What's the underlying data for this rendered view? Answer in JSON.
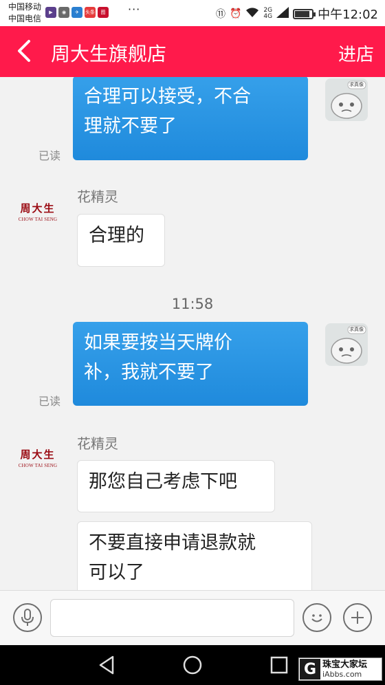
{
  "status_bar": {
    "carrier1": "中国移动",
    "carrier2": "中国电信",
    "app_badge_1": "头条",
    "app_badge_2": "图",
    "dots": "···",
    "network1": "2G",
    "network2": "4G",
    "time": "中午12:02",
    "battery_level": 0.85
  },
  "header": {
    "title": "周大生旗舰店",
    "action": "进店"
  },
  "messages": {
    "m1": {
      "line1": "合理可以接受，不合",
      "line2": "理就不要了",
      "read": "已读"
    },
    "m2": {
      "sender": "花精灵",
      "text": "合理的"
    },
    "timestamp": "11:58",
    "m3": {
      "line1": "如果要按当天牌价",
      "line2": "补，我就不要了",
      "read": "已读"
    },
    "m4": {
      "sender": "花精灵",
      "text": "那您自己考虑下吧"
    },
    "m5": {
      "line1": "不要直接申请退款就",
      "line2": "可以了"
    }
  },
  "avatars": {
    "me_badge": "求真像",
    "shop_cn": "周大生",
    "shop_en": "CHOW TAI SENG"
  },
  "input": {
    "value": ""
  },
  "watermark": {
    "logo": "G",
    "cn": "珠宝大家坛",
    "en": "iAbbs.com"
  }
}
